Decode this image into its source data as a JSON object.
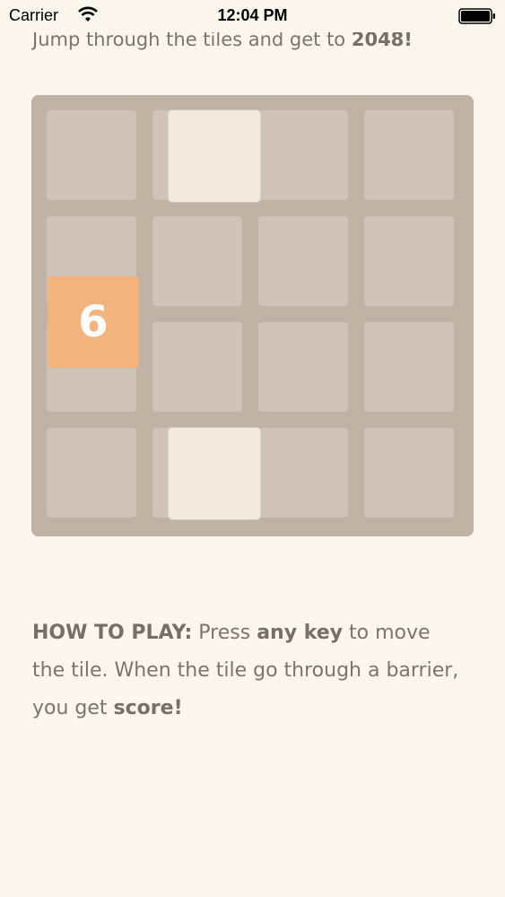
{
  "status_bar": {
    "carrier": "Carrier",
    "time": "12:04 PM",
    "wifi_icon": "wifi-icon",
    "battery_icon": "battery-icon"
  },
  "intro": {
    "prefix": "Jump through the tiles and get to ",
    "goal": "2048",
    "suffix": "!"
  },
  "board": {
    "rows": 4,
    "cols": 4,
    "player": {
      "value": "6",
      "color": "#f2b179"
    },
    "barrier_color": "#f2e8dc",
    "board_color": "#bbada0",
    "cell_color": "#cdc0b4"
  },
  "howto": {
    "heading": "HOW TO PLAY:",
    "t1": " Press ",
    "key": "any key",
    "t2": " to move the tile. When the tile go through a barrier, you get ",
    "score": "score!"
  },
  "colors": {
    "background": "#fbf6ee",
    "text": "#7c7469"
  }
}
